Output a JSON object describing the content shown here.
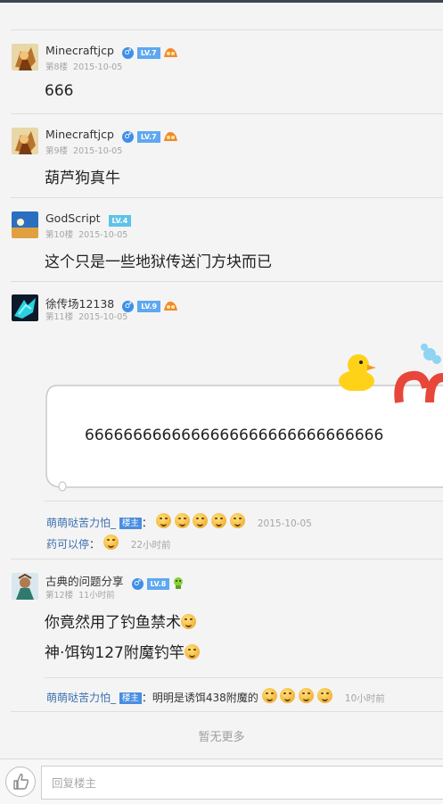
{
  "posts": [
    {
      "username": "Minecraftjcp",
      "floor": "第8楼",
      "date": "2015-10-05",
      "level": "LV.7",
      "content": "666"
    },
    {
      "username": "Minecraftjcp",
      "floor": "第9楼",
      "date": "2015-10-05",
      "level": "LV.7",
      "content": "葫芦狗真牛"
    },
    {
      "username": "GodScript",
      "floor": "第10楼",
      "date": "2015-10-05",
      "level": "LV.4",
      "content": "这个只是一些地狱传送门方块而已"
    },
    {
      "username": "徐传场12138",
      "floor": "第11楼",
      "date": "2015-10-05",
      "level": "LV.9",
      "content": "6666666666666666666666666666666",
      "replies": [
        {
          "name": "萌萌哒苦力怕_",
          "tag": "楼主",
          "sep": "：",
          "time": "2015-10-05"
        },
        {
          "name": "药可以停",
          "sep": "：",
          "time": "22小时前"
        }
      ]
    },
    {
      "username": "古典的问题分享",
      "floor": "第12楼",
      "date": "11小时前",
      "level": "LV.8",
      "content_line1": "你竟然用了钓鱼禁术",
      "content_line2": "神·饵钩127附魔钓竿",
      "replies": [
        {
          "name": "萌萌哒苦力怕_",
          "tag": "楼主",
          "sep": "：",
          "text": "明明是诱饵438附魔的",
          "time": "10小时前"
        }
      ]
    }
  ],
  "gender_symbol": "♂",
  "no_more": "暂无更多",
  "reply_placeholder": "回复楼主",
  "colors": {
    "accent": "#3f8ee8",
    "link": "#3c6fb0"
  }
}
